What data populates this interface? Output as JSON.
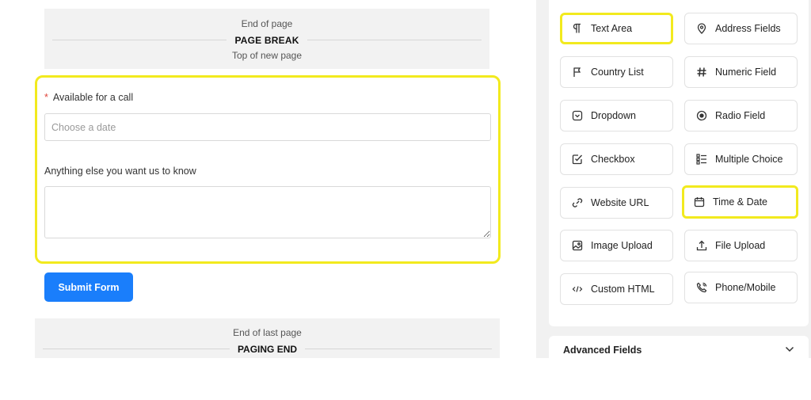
{
  "page_break": {
    "end_text": "End of page",
    "title": "PAGE BREAK",
    "top_text": "Top of new page"
  },
  "form": {
    "call_field": {
      "label": "Available for a call",
      "required_mark": "*",
      "placeholder": "Choose a date"
    },
    "extra_field": {
      "label": "Anything else you want us to know",
      "value": ""
    },
    "submit_label": "Submit Form"
  },
  "paging_end": {
    "end_text": "End of last page",
    "title": "PAGING END"
  },
  "palette": {
    "fields": [
      {
        "label": "Text Area",
        "icon": "paragraph-icon",
        "highlighted": true
      },
      {
        "label": "Address Fields",
        "icon": "map-pin-icon",
        "highlighted": false
      },
      {
        "label": "Country List",
        "icon": "flag-icon",
        "highlighted": false
      },
      {
        "label": "Numeric Field",
        "icon": "hash-icon",
        "highlighted": false
      },
      {
        "label": "Dropdown",
        "icon": "dropdown-icon",
        "highlighted": false
      },
      {
        "label": "Radio Field",
        "icon": "radio-icon",
        "highlighted": false
      },
      {
        "label": "Checkbox",
        "icon": "checkbox-icon",
        "highlighted": false
      },
      {
        "label": "Multiple Choice",
        "icon": "list-icon",
        "highlighted": false
      },
      {
        "label": "Website URL",
        "icon": "link-icon",
        "highlighted": false
      },
      {
        "label": "Time & Date",
        "icon": "calendar-icon",
        "highlighted": true
      },
      {
        "label": "Image Upload",
        "icon": "image-icon",
        "highlighted": false
      },
      {
        "label": "File Upload",
        "icon": "upload-icon",
        "highlighted": false
      },
      {
        "label": "Custom HTML",
        "icon": "code-icon",
        "highlighted": false
      },
      {
        "label": "Phone/Mobile",
        "icon": "phone-icon",
        "highlighted": false
      }
    ],
    "advanced_label": "Advanced Fields"
  },
  "colors": {
    "highlight": "#f2ea1e",
    "primary_button": "#1a7efb",
    "required": "#e0463c"
  }
}
